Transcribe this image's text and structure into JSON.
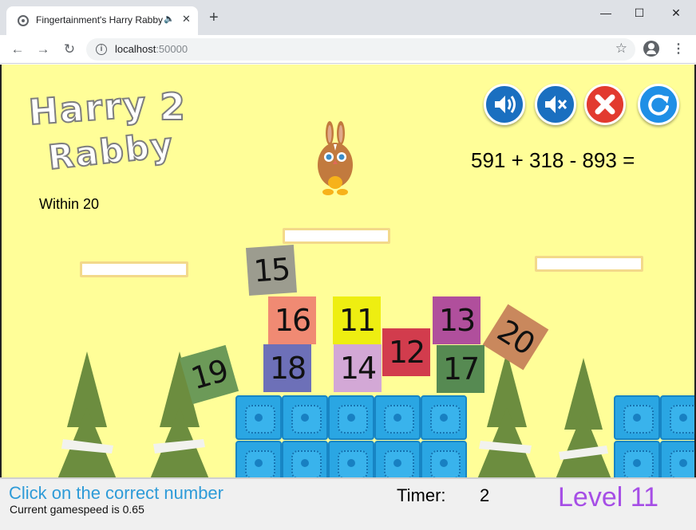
{
  "browser": {
    "tab_title": "Fingertainment's Harry Rabby",
    "tab_audio_icon": "speaker-icon",
    "new_tab_symbol": "+",
    "url_host": "localhost",
    "url_port": ":50000"
  },
  "game": {
    "logo": {
      "line1": "Harry",
      "number": "2",
      "line2": "Rabby"
    },
    "difficulty": "Within 20",
    "equation": "591 + 318 - 893 =",
    "buttons": [
      {
        "name": "sound-on-button",
        "icon": "speaker-on-icon",
        "color": "#1a6fc0"
      },
      {
        "name": "mute-button",
        "icon": "speaker-mute-icon",
        "color": "#1a6fc0"
      },
      {
        "name": "quit-button",
        "icon": "close-icon",
        "color": "#e23a2f"
      },
      {
        "name": "restart-button",
        "icon": "refresh-icon",
        "color": "#1f8fe6"
      }
    ],
    "number_tiles": [
      {
        "value": "15",
        "color": "#9c9c8f"
      },
      {
        "value": "16",
        "color": "#f08a73"
      },
      {
        "value": "11",
        "color": "#eeee11"
      },
      {
        "value": "13",
        "color": "#b04f9c"
      },
      {
        "value": "20",
        "color": "#c9885d"
      },
      {
        "value": "19",
        "color": "#6c9a58"
      },
      {
        "value": "18",
        "color": "#6d70b8"
      },
      {
        "value": "14",
        "color": "#d3a8d6"
      },
      {
        "value": "12",
        "color": "#d23c4d"
      },
      {
        "value": "17",
        "color": "#568a52"
      }
    ]
  },
  "status": {
    "instruction": "Click on the correct number",
    "speed": "Current gamespeed is 0.65",
    "timer_label": "Timer:",
    "timer_value": "2",
    "level": "Level 11"
  }
}
